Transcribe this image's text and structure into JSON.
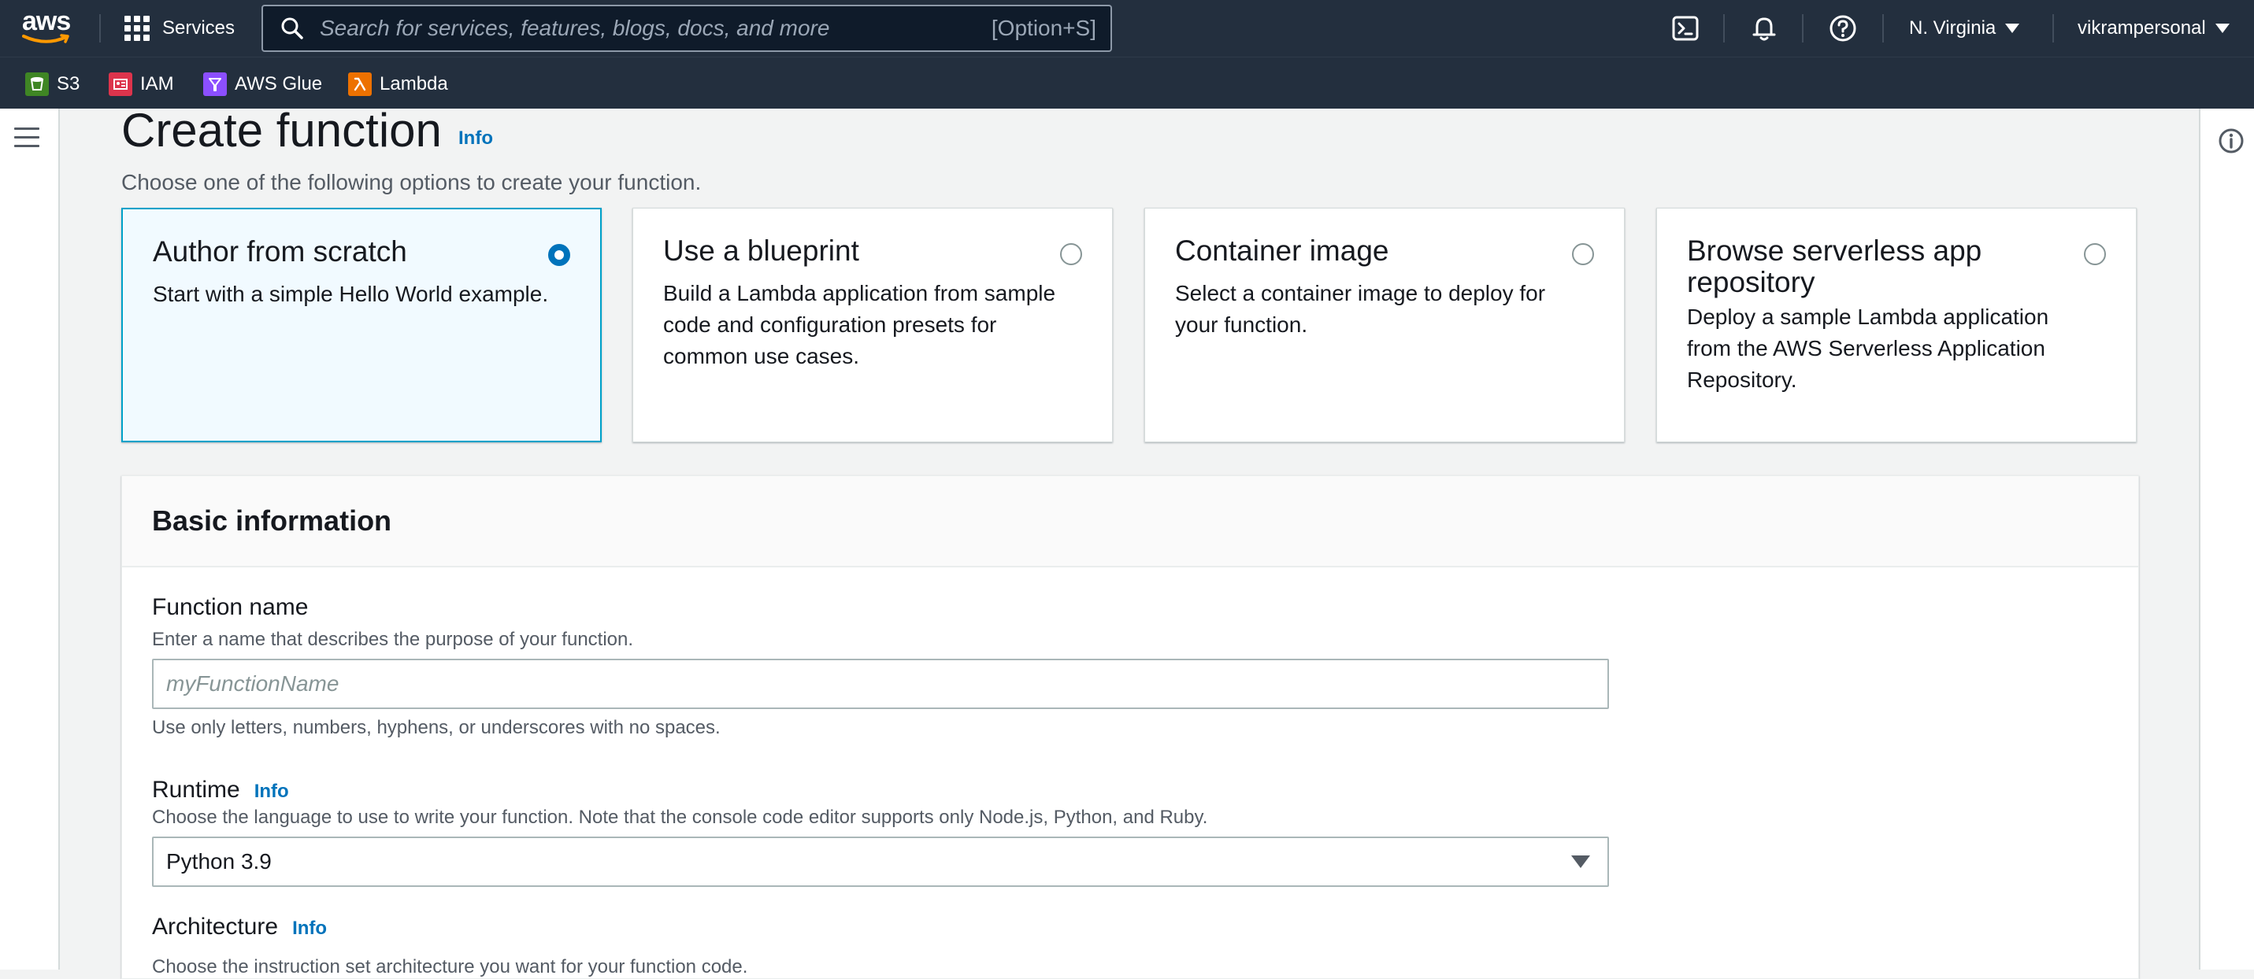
{
  "topnav": {
    "logo_text": "aws",
    "services_label": "Services",
    "search_placeholder": "Search for services, features, blogs, docs, and more",
    "search_shortcut": "[Option+S]",
    "region": "N. Virginia",
    "account": "vikrampersonal",
    "icons": [
      "cloudshell-icon",
      "bell-icon",
      "help-icon"
    ]
  },
  "favorites": [
    {
      "label": "S3",
      "color": "#3f8624"
    },
    {
      "label": "IAM",
      "color": "#dd344c"
    },
    {
      "label": "AWS Glue",
      "color": "#8c4fff"
    },
    {
      "label": "Lambda",
      "color": "#ed7100"
    }
  ],
  "page": {
    "title": "Create function",
    "title_info": "Info",
    "description": "Choose one of the following options to create your function."
  },
  "options": [
    {
      "title": "Author from scratch",
      "description": "Start with a simple Hello World example.",
      "selected": true
    },
    {
      "title": "Use a blueprint",
      "description": "Build a Lambda application from sample code and configuration presets for common use cases.",
      "selected": false
    },
    {
      "title": "Container image",
      "description": "Select a container image to deploy for your function.",
      "selected": false
    },
    {
      "title": "Browse serverless app repository",
      "description": "Deploy a sample Lambda application from the AWS Serverless Application Repository.",
      "selected": false
    }
  ],
  "basic_info": {
    "heading": "Basic information",
    "function_name": {
      "label": "Function name",
      "description": "Enter a name that describes the purpose of your function.",
      "placeholder": "myFunctionName",
      "value": "",
      "constraint": "Use only letters, numbers, hyphens, or underscores with no spaces."
    },
    "runtime": {
      "label": "Runtime",
      "info": "Info",
      "description": "Choose the language to use to write your function. Note that the console code editor supports only Node.js, Python, and Ruby.",
      "value": "Python 3.9"
    },
    "architecture": {
      "label": "Architecture",
      "info": "Info",
      "description": "Choose the instruction set architecture you want for your function code."
    }
  }
}
